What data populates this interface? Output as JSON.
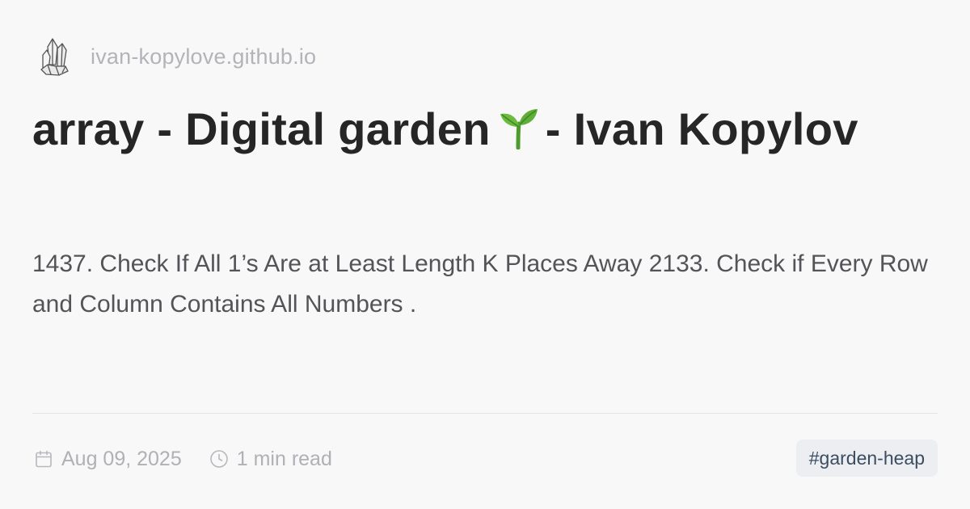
{
  "site": {
    "domain": "ivan-kopylove.github.io",
    "logo_icon": "crystal-icon"
  },
  "post": {
    "title_before": "array - Digital garden",
    "title_emoji_icon": "seedling-icon",
    "title_after": "- Ivan Kopylov",
    "description": "1437. Check If All 1’s Are at Least Length K Places Away 2133. Check if Every Row and Column Contains All Numbers ."
  },
  "meta": {
    "date": "Aug 09, 2025",
    "date_icon": "calendar-icon",
    "read_time": "1 min read",
    "read_time_icon": "clock-icon"
  },
  "tag": {
    "label": "#garden-heap"
  },
  "colors": {
    "background": "#f8f8f9",
    "title": "#262626",
    "muted": "#b0b0b5",
    "tag_bg": "#eceef1",
    "tag_text": "#3b4d61",
    "sprout_green": "#5fae3a"
  }
}
